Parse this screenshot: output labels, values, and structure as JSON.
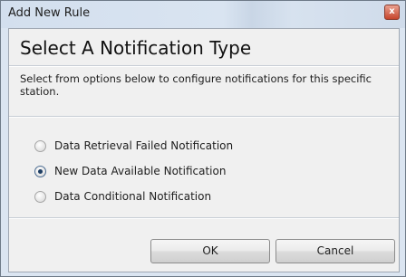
{
  "window": {
    "title": "Add New Rule",
    "close_glyph": "x"
  },
  "dialog": {
    "heading": "Select A Notification Type",
    "description": "Select from options below to configure notifications for this specific station."
  },
  "options": [
    {
      "label": "Data Retrieval Failed Notification",
      "selected": false
    },
    {
      "label": "New Data Available Notification",
      "selected": true
    },
    {
      "label": "Data Conditional Notification",
      "selected": false
    }
  ],
  "buttons": {
    "ok_label": "OK",
    "cancel_label": "Cancel"
  }
}
